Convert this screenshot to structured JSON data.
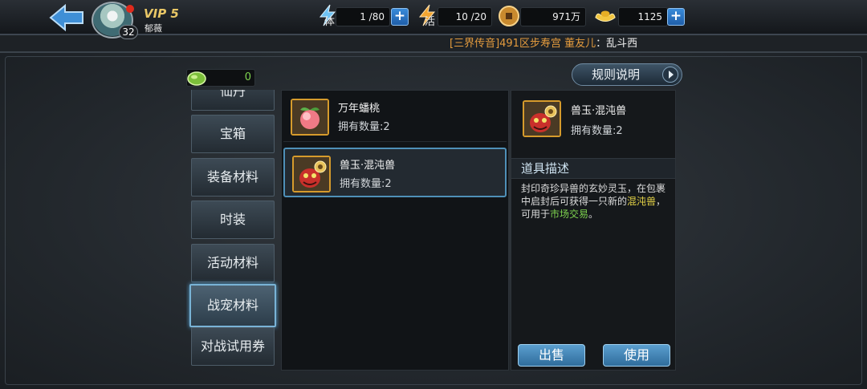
{
  "header": {
    "vip": "VIP 5",
    "player_name": "郁薇",
    "level": "32",
    "stamina_char": "体",
    "stamina": "1 /80",
    "energy_char": "活",
    "energy": "10 /20",
    "coins": "971万",
    "gold": "1125",
    "plus": "+"
  },
  "ticker": {
    "channel_server": "[三界传音]491区步寿宫 董友儿",
    "message": "：乱斗西"
  },
  "jade": {
    "count": "0"
  },
  "rules_button": "规则说明",
  "categories": [
    {
      "label": "仙丹"
    },
    {
      "label": "宝箱"
    },
    {
      "label": "装备材料"
    },
    {
      "label": "时装"
    },
    {
      "label": "活动材料"
    },
    {
      "label": "战宠材料"
    },
    {
      "label": "对战试用券"
    }
  ],
  "items": [
    {
      "name": "万年蟠桃",
      "qty": "拥有数量:2"
    },
    {
      "name": "兽玉·混沌兽",
      "qty": "拥有数量:2"
    }
  ],
  "detail": {
    "name": "兽玉·混沌兽",
    "qty": "拥有数量:2",
    "desc_title": "道具描述",
    "desc_1": "封印奇珍异兽的玄妙灵玉，在包裹中启封后可获得一只新的",
    "desc_highlight": "混沌兽",
    "desc_2": "，可用于",
    "desc_link": "市场交易",
    "desc_end": "。",
    "sell": "出售",
    "use": "使用"
  },
  "colors": {
    "accent_blue": "#4f90b8",
    "gold_text": "#e9c766",
    "ticker_orange": "#e39b3e",
    "highlight_yellow": "#e6d447",
    "highlight_green": "#7ed34f"
  },
  "icons": {
    "back": "back-arrow-icon",
    "stamina": "stamina-lightning-icon",
    "energy": "energy-lightning-icon",
    "coin": "copper-coin-icon",
    "gold": "gold-ingot-icon",
    "jade": "jade-currency-icon",
    "peach": "peach-icon",
    "beast": "beast-jade-icon"
  }
}
